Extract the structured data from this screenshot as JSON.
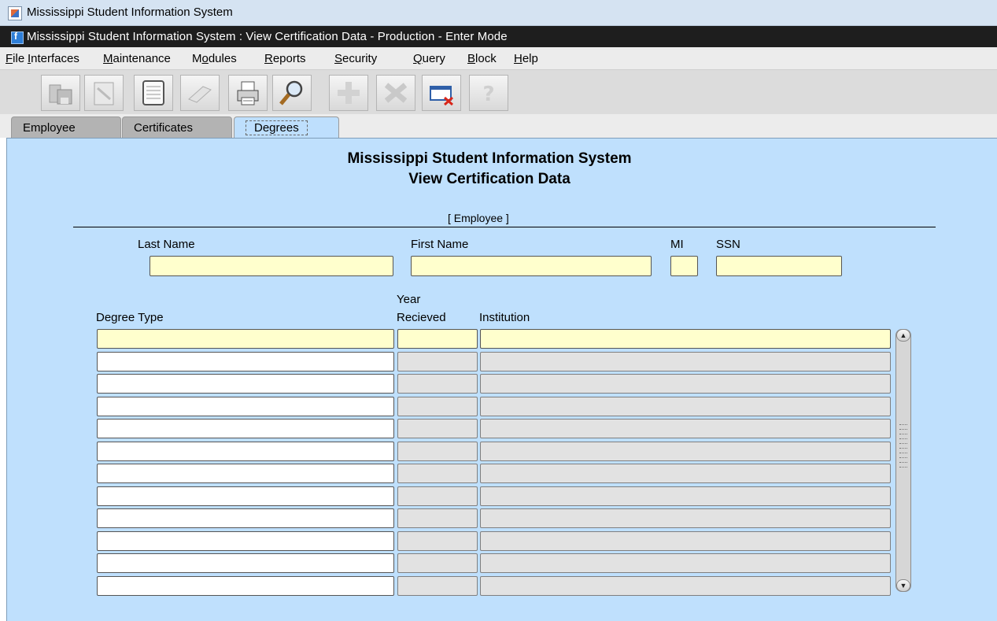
{
  "os_window": {
    "title": "Mississippi Student Information System"
  },
  "app_window": {
    "title": "Mississippi Student Information System : View Certification Data  -  Production  -  Enter Mode"
  },
  "menu": {
    "items": [
      {
        "mnemonic": "F",
        "rest": "ile"
      },
      {
        "mnemonic": "I",
        "rest": "nterfaces"
      },
      {
        "mnemonic": "M",
        "rest": "aintenance"
      },
      {
        "pre": "M",
        "mnemonic": "o",
        "rest": "dules"
      },
      {
        "mnemonic": "R",
        "rest": "eports"
      },
      {
        "mnemonic": "S",
        "rest": "ecurity"
      },
      {
        "mnemonic": "Q",
        "rest": "uery"
      },
      {
        "mnemonic": "B",
        "rest": "lock"
      },
      {
        "mnemonic": "H",
        "rest": "elp"
      }
    ]
  },
  "toolbar": {
    "icons": [
      "save-icon",
      "edit-icon",
      "list-icon",
      "remove-icon",
      "print-icon",
      "search-icon",
      "insert-record-icon",
      "delete-record-icon",
      "exit-icon",
      "help-icon"
    ]
  },
  "tabs": [
    {
      "label": "Employee",
      "active": false
    },
    {
      "label": "Certificates",
      "active": false
    },
    {
      "label": "Degrees",
      "active": true
    }
  ],
  "form": {
    "heading_line1": "Mississippi Student Information System",
    "heading_line2": "View Certification Data",
    "employee_section": "[ Employee ]",
    "labels": {
      "last_name": "Last Name",
      "first_name": "First Name",
      "mi": "MI",
      "ssn": "SSN"
    },
    "values": {
      "last_name": "",
      "first_name": "",
      "mi": "",
      "ssn": ""
    },
    "degrees": {
      "col_degree_type": "Degree Type",
      "col_year_line1": "Year",
      "col_year_line2": "Recieved",
      "col_institution": "Institution",
      "row_count": 12
    }
  },
  "colors": {
    "canvas": "#bfe0fd",
    "required_field": "#ffffcd",
    "active_tab": "#bedffd"
  }
}
